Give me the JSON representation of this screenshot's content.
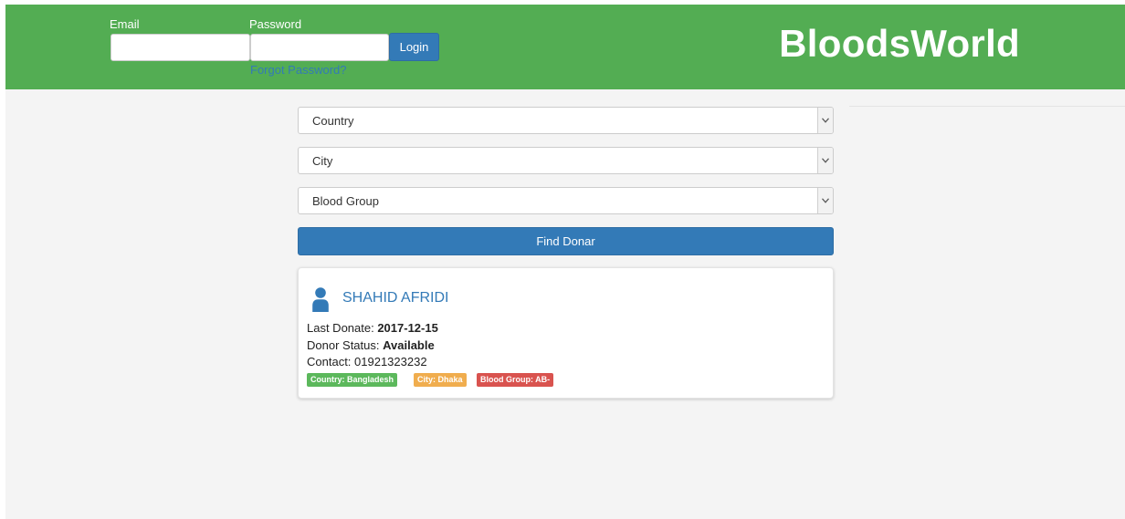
{
  "header": {
    "email_label": "Email",
    "email_value": "",
    "password_label": "Password",
    "password_value": "",
    "login_label": "Login",
    "forgot_link": "Forgot Password?",
    "brand": "BloodsWorld",
    "bg_color": "#53ad53"
  },
  "search": {
    "country_select": "Country",
    "city_select": "City",
    "blood_group_select": "Blood Group",
    "find_button": "Find Donar",
    "button_color": "#337ab7"
  },
  "donor": {
    "icon": "user-icon",
    "name": "SHAHID AFRIDI",
    "last_donate_label": "Last Donate: ",
    "last_donate_value": "2017-12-15",
    "status_label": "Donor Status: ",
    "status_value": "Available",
    "contact_label": "Contact: ",
    "contact_value": "01921323232",
    "tags": [
      {
        "label": "Country: Bangladesh",
        "color": "#5cb85c"
      },
      {
        "label": "City: Dhaka",
        "color": "#f0ad4e"
      },
      {
        "label": "Blood Group: AB-",
        "color": "#d9534f"
      }
    ]
  }
}
